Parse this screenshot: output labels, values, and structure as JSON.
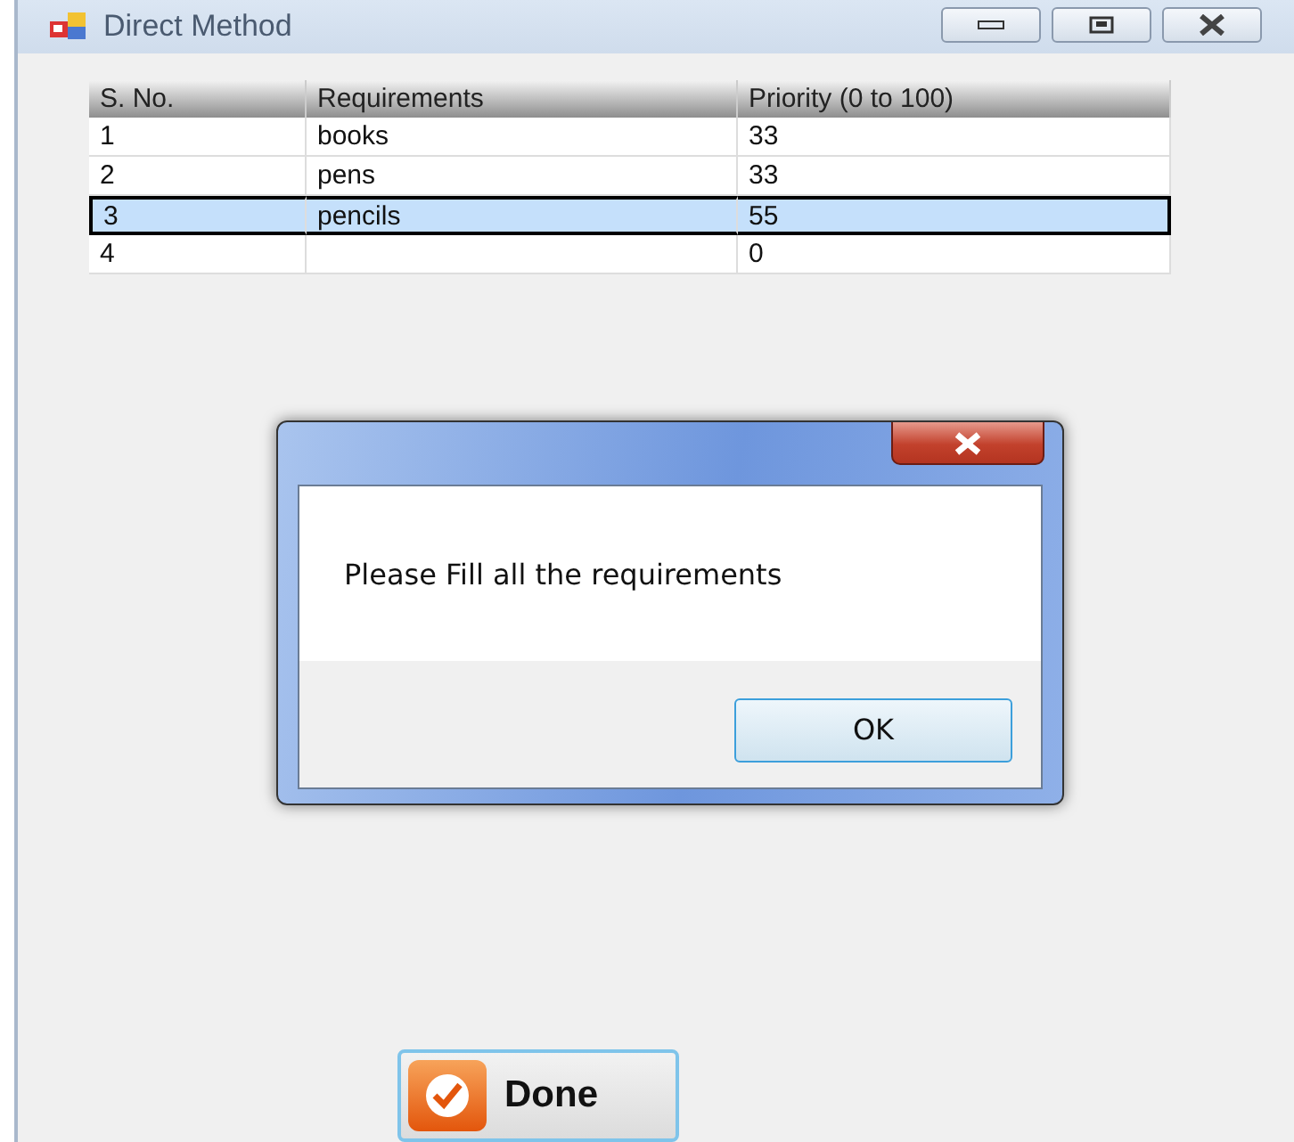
{
  "window": {
    "title": "Direct Method"
  },
  "table": {
    "columns": [
      "S. No.",
      "Requirements",
      "Priority (0 to 100)"
    ],
    "rows": [
      {
        "cells": [
          "1",
          "books",
          "33"
        ],
        "selected": false
      },
      {
        "cells": [
          "2",
          "pens",
          "33"
        ],
        "selected": false
      },
      {
        "cells": [
          "3",
          "pencils",
          "55"
        ],
        "selected": true
      },
      {
        "cells": [
          "4",
          "",
          "0"
        ],
        "selected": false
      }
    ]
  },
  "done_button": {
    "label": "Done"
  },
  "dialog": {
    "message": "Please Fill all the requirements",
    "button": "OK"
  }
}
